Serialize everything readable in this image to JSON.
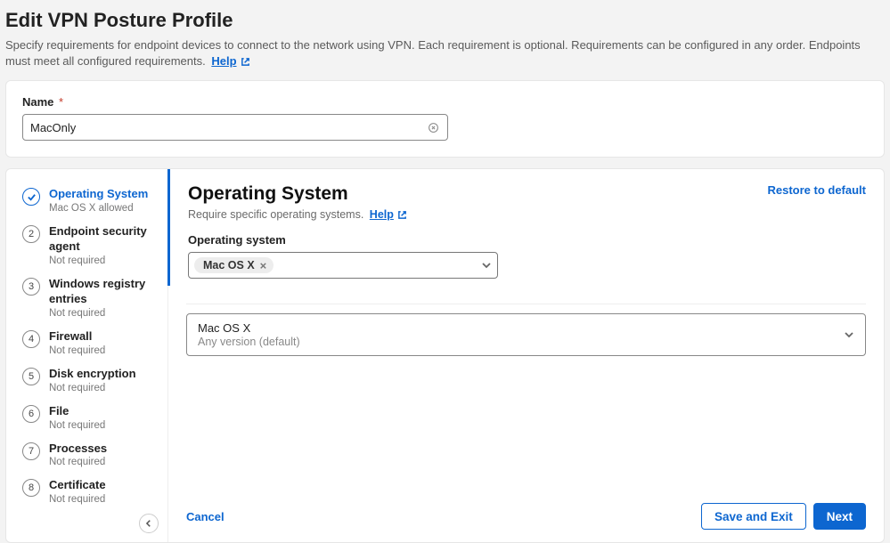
{
  "header": {
    "title": "Edit VPN Posture Profile",
    "description": "Specify requirements for endpoint devices to connect to the network using VPN. Each requirement is optional. Requirements can be configured in any order. Endpoints must meet all configured requirements.",
    "help_label": "Help"
  },
  "name_field": {
    "label": "Name",
    "required_mark": "*",
    "value": "MacOnly"
  },
  "steps": [
    {
      "title": "Operating System",
      "sub": "Mac OS X allowed",
      "active": true,
      "check": true
    },
    {
      "title": "Endpoint security agent",
      "sub": "Not required"
    },
    {
      "title": "Windows registry entries",
      "sub": "Not required"
    },
    {
      "title": "Firewall",
      "sub": "Not required"
    },
    {
      "title": "Disk encryption",
      "sub": "Not required"
    },
    {
      "title": "File",
      "sub": "Not required"
    },
    {
      "title": "Processes",
      "sub": "Not required"
    },
    {
      "title": "Certificate",
      "sub": "Not required"
    }
  ],
  "main": {
    "section_title": "Operating System",
    "section_desc": "Require specific operating systems.",
    "help_label": "Help",
    "restore_label": "Restore to default",
    "os_label": "Operating system",
    "chip_value": "Mac OS X",
    "version_title": "Mac OS X",
    "version_sub": "Any version (default)"
  },
  "footer": {
    "cancel": "Cancel",
    "save_exit": "Save and Exit",
    "next": "Next"
  },
  "step_numbers": {
    "n2": "2",
    "n3": "3",
    "n4": "4",
    "n5": "5",
    "n6": "6",
    "n7": "7",
    "n8": "8"
  }
}
